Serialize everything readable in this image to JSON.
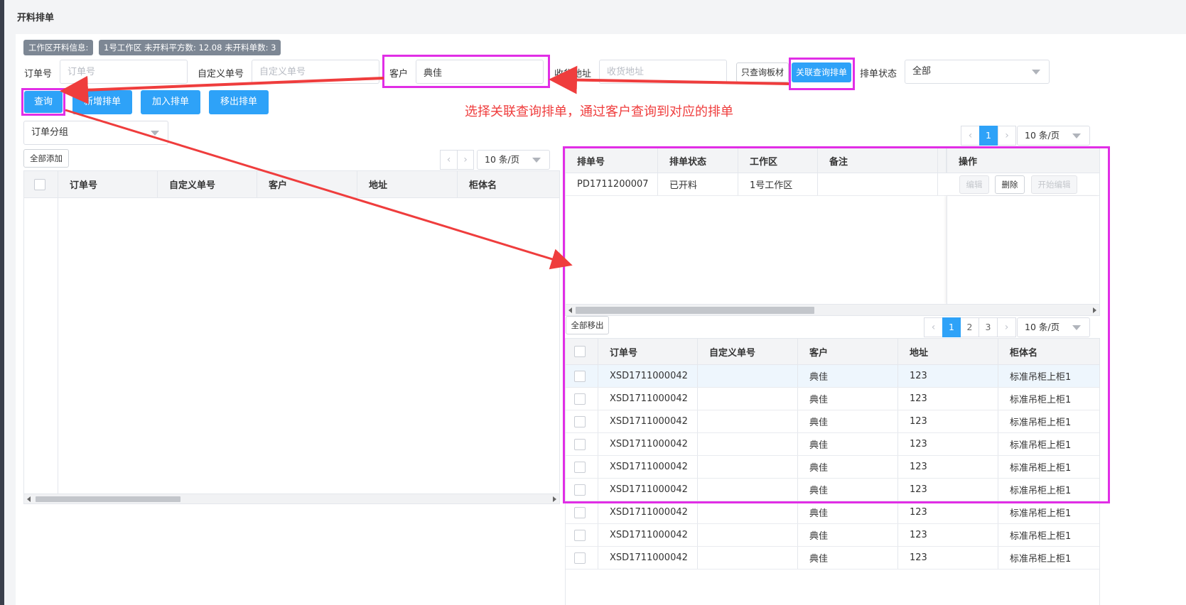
{
  "page": {
    "title": "开料排单"
  },
  "info": {
    "label": "工作区开料信息:",
    "value": "1号工作区 未开料平方数: 12.08 未开料单数: 3"
  },
  "filters": {
    "order_no_label": "订单号",
    "order_no_placeholder": "订单号",
    "custom_no_label": "自定义单号",
    "custom_no_placeholder": "自定义单号",
    "customer_label": "客户",
    "customer_value": "典佳",
    "address_label": "收货地址",
    "address_placeholder": "收货地址",
    "only_board_label": "只查询板材",
    "linked_query_label": "关联查询排单",
    "status_label": "排单状态",
    "status_value": "全部"
  },
  "actions": {
    "query": "查询",
    "new_schedule": "新增排单",
    "add_schedule": "加入排单",
    "remove_schedule": "移出排单"
  },
  "annotation": "选择关联查询排单，通过客户查询到对应的排单",
  "left": {
    "group_select": "订单分组",
    "add_all": "全部添加",
    "page_size": "10 条/页",
    "columns": [
      "订单号",
      "自定义单号",
      "客户",
      "地址",
      "柜体名"
    ]
  },
  "schedule": {
    "page": "1",
    "page_size": "10 条/页",
    "columns": [
      "排单号",
      "排单状态",
      "工作区",
      "备注",
      "操作"
    ],
    "rows": [
      {
        "no": "PD1711200007",
        "status": "已开料",
        "area": "1号工作区",
        "note": ""
      }
    ],
    "ops": {
      "edit": "编辑",
      "delete": "删除",
      "start_edit": "开始编辑"
    }
  },
  "detail": {
    "remove_all": "全部移出",
    "pages": [
      "1",
      "2",
      "3"
    ],
    "page_size": "10 条/页",
    "columns": [
      "订单号",
      "自定义单号",
      "客户",
      "地址",
      "柜体名"
    ],
    "rows": [
      {
        "order": "XSD1711000042",
        "custom": "",
        "customer": "典佳",
        "address": "123",
        "cabinet": "标准吊柜上柜1"
      },
      {
        "order": "XSD1711000042",
        "custom": "",
        "customer": "典佳",
        "address": "123",
        "cabinet": "标准吊柜上柜1"
      },
      {
        "order": "XSD1711000042",
        "custom": "",
        "customer": "典佳",
        "address": "123",
        "cabinet": "标准吊柜上柜1"
      },
      {
        "order": "XSD1711000042",
        "custom": "",
        "customer": "典佳",
        "address": "123",
        "cabinet": "标准吊柜上柜1"
      },
      {
        "order": "XSD1711000042",
        "custom": "",
        "customer": "典佳",
        "address": "123",
        "cabinet": "标准吊柜上柜1"
      },
      {
        "order": "XSD1711000042",
        "custom": "",
        "customer": "典佳",
        "address": "123",
        "cabinet": "标准吊柜上柜1"
      },
      {
        "order": "XSD1711000042",
        "custom": "",
        "customer": "典佳",
        "address": "123",
        "cabinet": "标准吊柜上柜1"
      },
      {
        "order": "XSD1711000042",
        "custom": "",
        "customer": "典佳",
        "address": "123",
        "cabinet": "标准吊柜上柜1"
      },
      {
        "order": "XSD1711000042",
        "custom": "",
        "customer": "典佳",
        "address": "123",
        "cabinet": "标准吊柜上柜1"
      }
    ]
  },
  "colors": {
    "primary": "#2ea2f8",
    "highlight": "#e12ee6",
    "arrow": "#ef3d3d"
  }
}
